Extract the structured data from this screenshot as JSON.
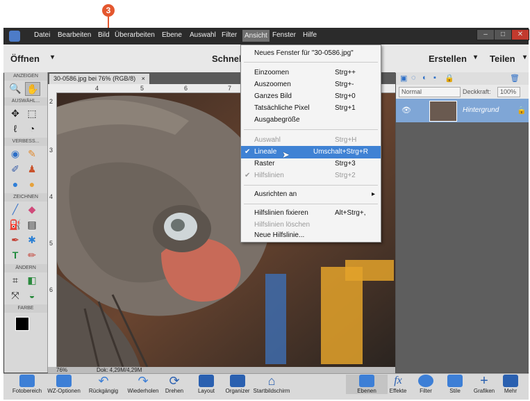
{
  "callout": {
    "number": "3"
  },
  "menubar": {
    "items": [
      "Datei",
      "Bearbeiten",
      "Bild",
      "Überarbeiten",
      "Ebene",
      "Auswahl",
      "Filter",
      "Ansicht",
      "Fenster",
      "Hilfe"
    ],
    "active": "Ansicht"
  },
  "toprow": {
    "open": "Öffnen",
    "mode": "Schnell",
    "create": "Erstellen",
    "share": "Teilen"
  },
  "tools": {
    "sections": [
      "ANZEIGEN",
      "AUSWÄHL...",
      "VERBESS...",
      "ZEICHNEN",
      "ÄNDERN",
      "FARBE"
    ]
  },
  "document": {
    "tab_title": "30-0586.jpg bei 76% (RGB/8)",
    "ruler_marks": [
      "4",
      "5",
      "6",
      "7"
    ],
    "vruler_marks": [
      "2",
      "3",
      "4",
      "5",
      "6"
    ],
    "zoom": "76%",
    "doc_info": "Dok: 4,29M/4,29M"
  },
  "layers": {
    "blend_mode": "Normal",
    "opacity_label": "Deckkraft:",
    "opacity_value": "100%",
    "layer_name": "Hintergrund"
  },
  "ansicht_menu": {
    "items": [
      {
        "label": "Neues Fenster für \"30-0586.jpg\"",
        "shortcut": ""
      },
      {
        "label": "Einzoomen",
        "shortcut": "Strg++"
      },
      {
        "label": "Auszoomen",
        "shortcut": "Strg+-"
      },
      {
        "label": "Ganzes Bild",
        "shortcut": "Strg+0"
      },
      {
        "label": "Tatsächliche Pixel",
        "shortcut": "Strg+1"
      },
      {
        "label": "Ausgabegröße",
        "shortcut": ""
      },
      {
        "label": "Auswahl",
        "shortcut": "Strg+H"
      },
      {
        "label": "Lineale",
        "shortcut": "Umschalt+Strg+R"
      },
      {
        "label": "Raster",
        "shortcut": "Strg+3"
      },
      {
        "label": "Hilfslinien",
        "shortcut": "Strg+2"
      },
      {
        "label": "Ausrichten an",
        "shortcut": "▸"
      },
      {
        "label": "Hilfslinien fixieren",
        "shortcut": "Alt+Strg+,"
      },
      {
        "label": "Hilfslinien löschen",
        "shortcut": ""
      },
      {
        "label": "Neue Hilfslinie...",
        "shortcut": ""
      }
    ]
  },
  "bottombar": {
    "items": [
      "Fotobereich",
      "WZ-Optionen",
      "Rückgängig",
      "Wiederholen",
      "Drehen",
      "Layout",
      "Organizer",
      "Startbildschirm",
      "Ebenen",
      "Effekte",
      "Filter",
      "Stile",
      "Grafiken",
      "Mehr"
    ]
  },
  "colors": {
    "highlight": "#3f82d4",
    "callout": "#e4572e",
    "layer_row": "#7fa6d6"
  }
}
